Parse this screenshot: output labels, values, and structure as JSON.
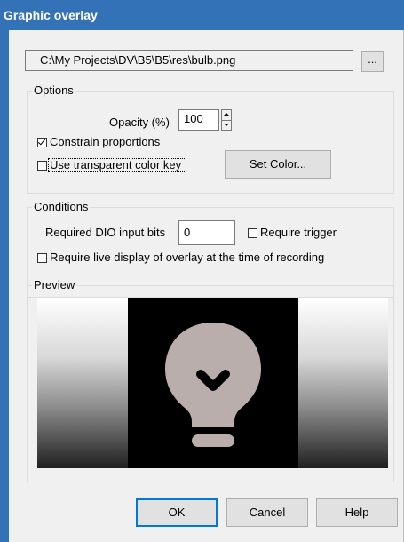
{
  "window": {
    "title": "Graphic overlay"
  },
  "file": {
    "path": "C:\\My Projects\\DV\\B5\\B5\\res\\bulb.png",
    "browse_label": "..."
  },
  "options": {
    "group_label": "Options",
    "opacity_label": "Opacity (%)",
    "opacity_value": "100",
    "constrain_label": "Constrain proportions",
    "constrain_checked": true,
    "transparent_label": "Use transparent color key",
    "transparent_checked": false,
    "set_color_label": "Set Color..."
  },
  "conditions": {
    "group_label": "Conditions",
    "dio_label": "Required DIO input bits",
    "dio_value": "0",
    "trigger_label": "Require trigger",
    "trigger_checked": false,
    "live_label": "Require live display of overlay at the time of recording",
    "live_checked": false
  },
  "preview": {
    "group_label": "Preview",
    "image_icon": "lightbulb-icon",
    "colors": {
      "bulb": "#b9aeab",
      "background": "#000000"
    }
  },
  "buttons": {
    "ok": "OK",
    "cancel": "Cancel",
    "help": "Help"
  },
  "colors": {
    "titlebar": "#3472b8",
    "accent": "#0078d7"
  }
}
